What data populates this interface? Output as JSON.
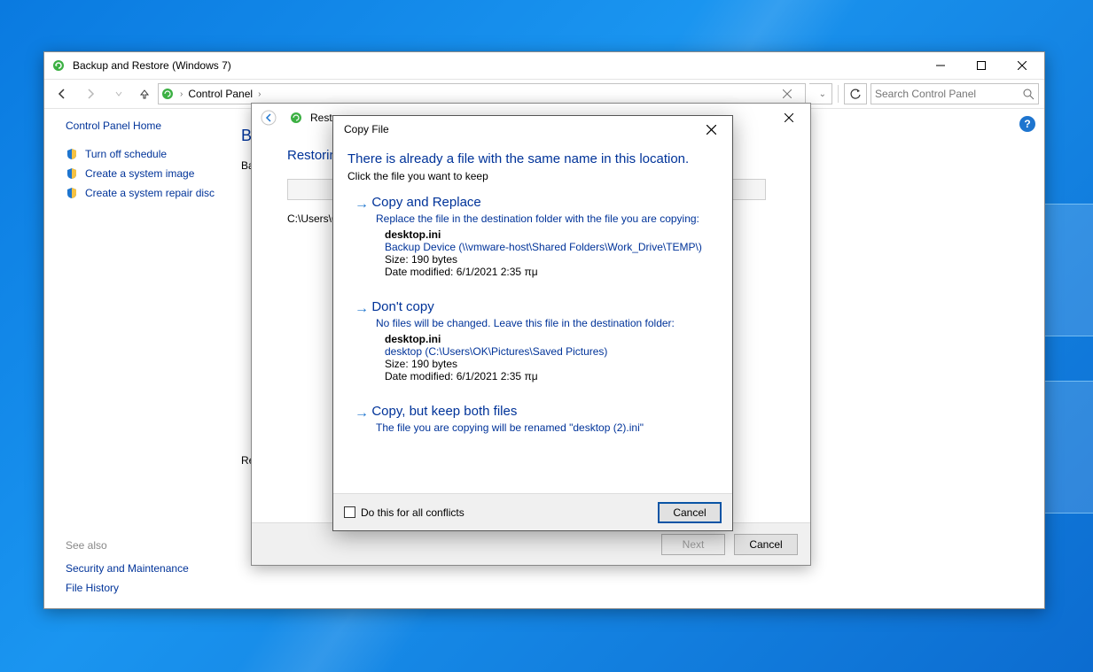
{
  "outer": {
    "title": "Backup and Restore (Windows 7)",
    "search_placeholder": "Search Control Panel",
    "breadcrumb": {
      "root": "Control Panel"
    },
    "left": {
      "home": "Control Panel Home",
      "links": [
        "Turn off schedule",
        "Create a system image",
        "Create a system repair disc"
      ],
      "see_also_heading": "See also",
      "see_also": [
        "Security and Maintenance",
        "File History"
      ]
    },
    "right": {
      "heading_fragment_b": "B",
      "heading_fragment_ba": "Ba",
      "re_fragment": "Re"
    }
  },
  "wizard": {
    "title": "Restor",
    "heading": "Restorin",
    "path": "C:\\Users\\O",
    "next": "Next",
    "cancel": "Cancel"
  },
  "dialog": {
    "title": "Copy File",
    "headline": "There is already a file with the same name in this location.",
    "subtitle": "Click the file you want to keep",
    "options": [
      {
        "title": "Copy and Replace",
        "desc": "Replace the file in the destination folder with the file you are copying:",
        "fname": "desktop.ini",
        "floc": "Backup Device (\\\\vmware-host\\Shared Folders\\Work_Drive\\TEMP\\)",
        "size": "Size: 190 bytes",
        "date": "Date modified: 6/1/2021 2:35 πμ"
      },
      {
        "title": "Don't copy",
        "desc": "No files will be changed. Leave this file in the destination folder:",
        "fname": "desktop.ini",
        "floc": "desktop (C:\\Users\\OK\\Pictures\\Saved Pictures)",
        "size": "Size: 190 bytes",
        "date": "Date modified: 6/1/2021 2:35 πμ"
      },
      {
        "title": "Copy, but keep both files",
        "desc": "The file you are copying will be renamed \"desktop (2).ini\""
      }
    ],
    "checkbox_label": "Do this for all conflicts",
    "cancel": "Cancel"
  }
}
